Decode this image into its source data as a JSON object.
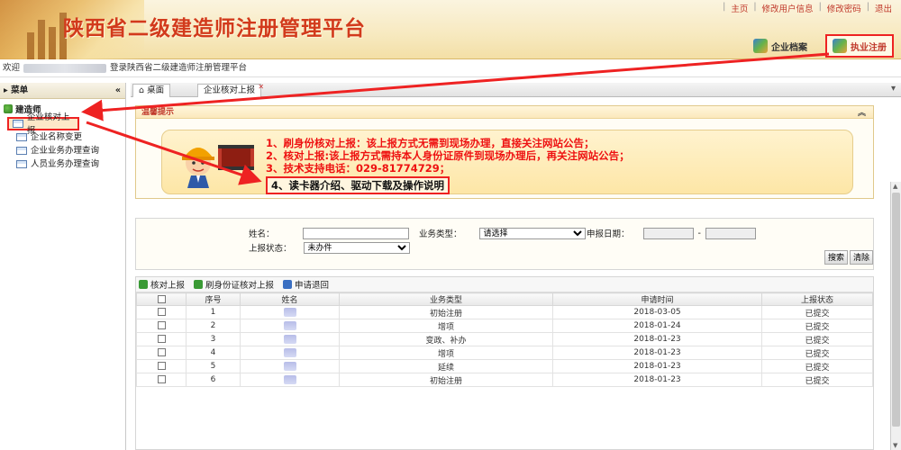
{
  "header": {
    "title": "陕西省二级建造师注册管理平台",
    "links": [
      "主页",
      "修改用户信息",
      "修改密码",
      "退出"
    ],
    "tabs": [
      {
        "label": "企业档案",
        "active": false
      },
      {
        "label": "执业注册",
        "active": true
      }
    ]
  },
  "welcome": {
    "prefix": "欢迎",
    "suffix": "登录陕西省二级建造师注册管理平台"
  },
  "sidebar": {
    "title": "菜单",
    "collapse_glyph": "«",
    "group": "建造师",
    "items": [
      {
        "label": "企业核对上报",
        "active": true
      },
      {
        "label": "企业名称变更",
        "active": false
      },
      {
        "label": "企业业务办理查询",
        "active": false
      },
      {
        "label": "人员业务办理查询",
        "active": false
      }
    ]
  },
  "tabs": [
    {
      "label": "桌面"
    },
    {
      "label": "企业核对上报"
    }
  ],
  "tips": {
    "title": "温馨提示",
    "lines": [
      "1、刷身份核对上报：该上报方式无需到现场办理，直接关注网站公告；",
      "2、核对上报:该上报方式需持本人身份证原件到现场办理后，再关注网站公告；",
      "3、技术支持电话：029-81774729；",
      "4、读卡器介绍、驱动下载及操作说明"
    ]
  },
  "search": {
    "name_label": "姓名：",
    "business_label": "业务类型：",
    "business_value": "请选择",
    "date_label": "申报日期：",
    "date_sep": "-",
    "status_label": "上报状态：",
    "status_value": "未办件",
    "search_btn": "搜索",
    "clear_btn": "清除"
  },
  "toolbar": [
    "核对上报",
    "刷身份证核对上报",
    "申请退回"
  ],
  "table": {
    "headers": [
      "序号",
      "姓名",
      "业务类型",
      "申请时间",
      "上报状态"
    ],
    "rows": [
      {
        "no": "1",
        "type": "初始注册",
        "date": "2018-03-05",
        "status": "已提交"
      },
      {
        "no": "2",
        "type": "增项",
        "date": "2018-01-24",
        "status": "已提交"
      },
      {
        "no": "3",
        "type": "变政、补办",
        "date": "2018-01-23",
        "status": "已提交"
      },
      {
        "no": "4",
        "type": "增项",
        "date": "2018-01-23",
        "status": "已提交"
      },
      {
        "no": "5",
        "type": "延续",
        "date": "2018-01-23",
        "status": "已提交"
      },
      {
        "no": "6",
        "type": "初始注册",
        "date": "2018-01-23",
        "status": "已提交"
      }
    ]
  },
  "colors": {
    "accent_red": "#e22222",
    "title_red": "#d23a1c"
  }
}
